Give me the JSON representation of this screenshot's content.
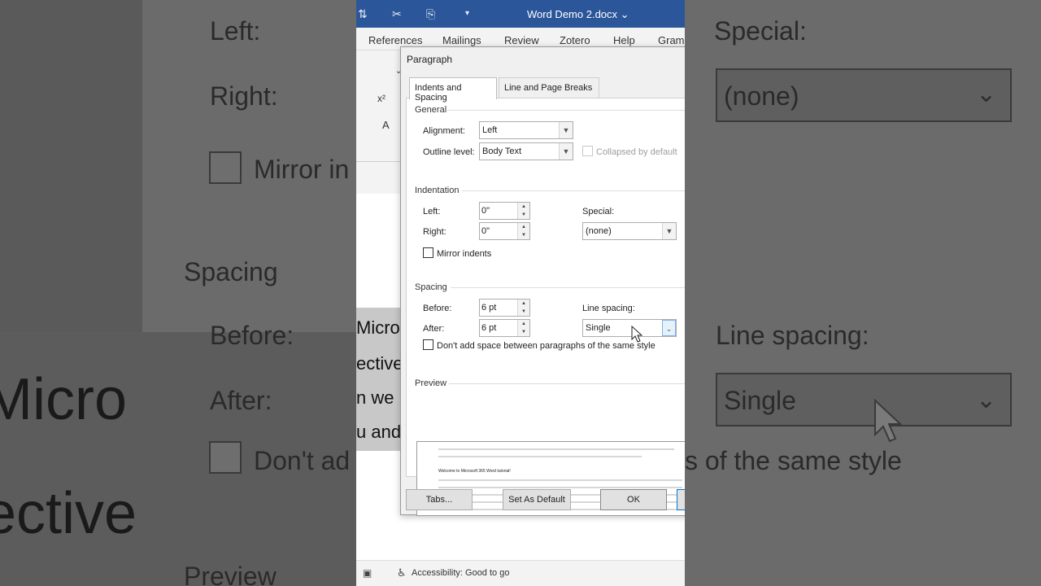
{
  "background": {
    "left_labels": {
      "left": "Left:",
      "right": "Right:",
      "mirror": "Mirror in",
      "spacing": "Spacing",
      "before": "Before:",
      "after": "After:",
      "dont_add": "Don't ad",
      "preview": "Preview",
      "big_text_1": "Micro",
      "big_text_2": "ective"
    },
    "right_labels": {
      "special": "Special:",
      "special_value": "(none)",
      "line_spacing": "Line spacing:",
      "line_spacing_value": "Single",
      "same_style": "s of the same style"
    }
  },
  "word": {
    "title": "Word Demo 2.docx",
    "title_chevron": "⌄",
    "ribbon_tabs": [
      "References",
      "Mailings",
      "Review",
      "Zotero",
      "Help",
      "Gram"
    ],
    "doc_lines": [
      "Micros",
      "ective",
      "n we",
      "u and"
    ],
    "status_accessibility": "Accessibility: Good to go"
  },
  "dialog": {
    "title": "Paragraph",
    "tabs": [
      "Indents and Spacing",
      "Line and Page Breaks"
    ],
    "general": {
      "section": "General",
      "alignment_label": "Alignment:",
      "alignment_value": "Left",
      "outline_label": "Outline level:",
      "outline_value": "Body Text",
      "collapsed_label": "Collapsed by default"
    },
    "indentation": {
      "section": "Indentation",
      "left_label": "Left:",
      "left_value": "0\"",
      "right_label": "Right:",
      "right_value": "0\"",
      "special_label": "Special:",
      "special_value": "(none)",
      "mirror_label": "Mirror indents"
    },
    "spacing": {
      "section": "Spacing",
      "before_label": "Before:",
      "before_value": "6 pt",
      "after_label": "After:",
      "after_value": "6 pt",
      "line_spacing_label": "Line spacing:",
      "line_spacing_value": "Single",
      "dont_add_label": "Don't add space between paragraphs of the same style"
    },
    "preview": {
      "section": "Preview",
      "sample_text": "Welcome to Microsoft 365 Word tutorial!"
    },
    "buttons": {
      "tabs": "Tabs...",
      "set_default": "Set As Default",
      "ok": "OK"
    }
  }
}
